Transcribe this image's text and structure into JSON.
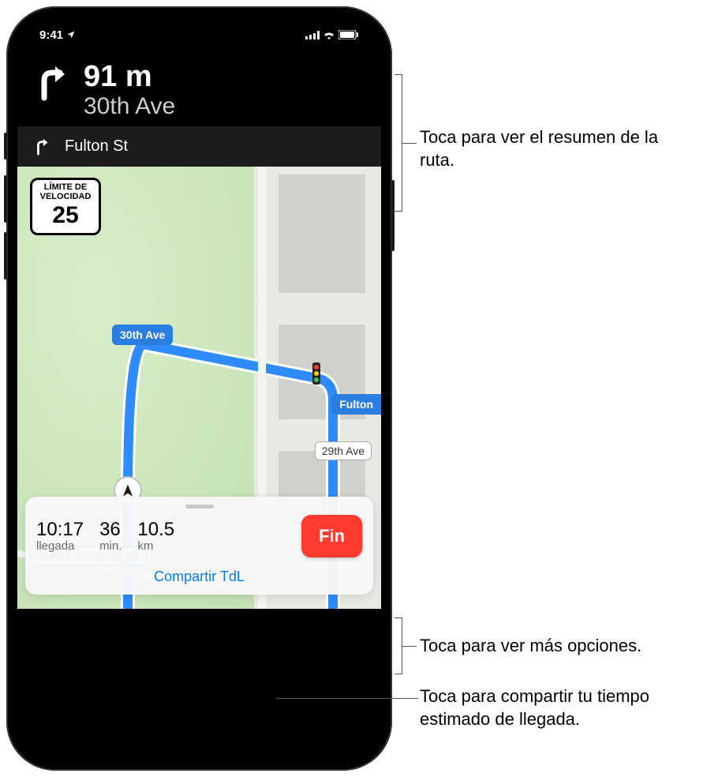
{
  "status": {
    "time": "9:41"
  },
  "nav": {
    "distance": "91 m",
    "street": "30th Ave",
    "next_street": "Fulton St"
  },
  "speed_limit": {
    "line1": "LÍMITE DE",
    "line2": "VELOCIDAD",
    "value": "25"
  },
  "map_labels": {
    "ave30": "30th Ave",
    "fulton": "Fulton",
    "ave29": "29th Ave",
    "jfk": "John F Kennedy Dr"
  },
  "bottom": {
    "arrival_value": "10:17",
    "arrival_label": "llegada",
    "time_value": "36",
    "time_label": "min.",
    "dist_value": "10.5",
    "dist_label": "km",
    "end_label": "Fin",
    "share_label": "Compartir TdL"
  },
  "callouts": {
    "route_summary": "Toca para ver el resumen de la ruta.",
    "more_options": "Toca para ver más opciones.",
    "share_eta": "Toca para compartir tu tiempo estimado de llegada."
  }
}
